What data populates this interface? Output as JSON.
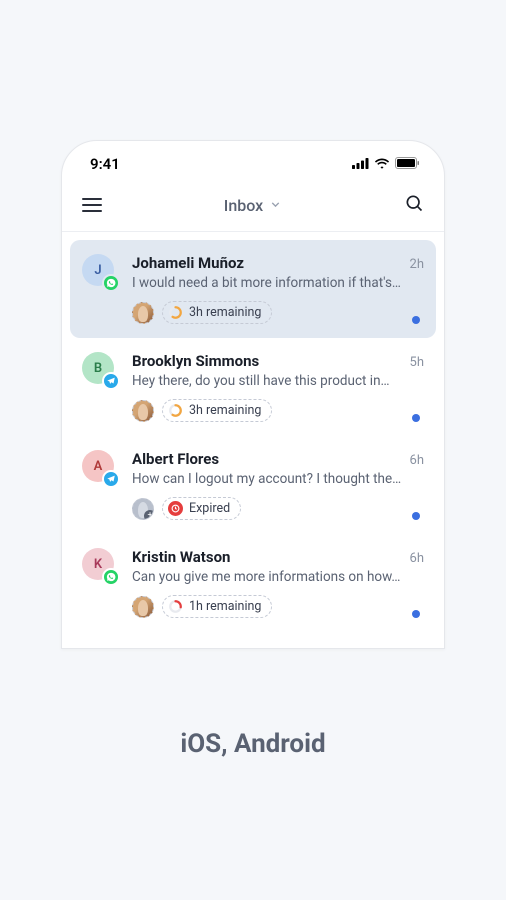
{
  "status_bar": {
    "time": "9:41"
  },
  "header": {
    "title": "Inbox"
  },
  "conversations": [
    {
      "initial": "J",
      "name": "Johameli Muñoz",
      "preview": "I would need a bit more information if that's…",
      "time": "2h",
      "sla_label": "3h remaining"
    },
    {
      "initial": "B",
      "name": "Brooklyn Simmons",
      "preview": "Hey there, do you still have this product in…",
      "time": "5h",
      "sla_label": "3h remaining"
    },
    {
      "initial": "A",
      "name": "Albert Flores",
      "preview": "How can I logout my account? I thought the…",
      "time": "6h",
      "sla_label": "Expired"
    },
    {
      "initial": "K",
      "name": "Kristin Watson",
      "preview": "Can you give me more informations on how…",
      "time": "6h",
      "sla_label": "1h remaining"
    }
  ],
  "caption": "iOS, Android"
}
